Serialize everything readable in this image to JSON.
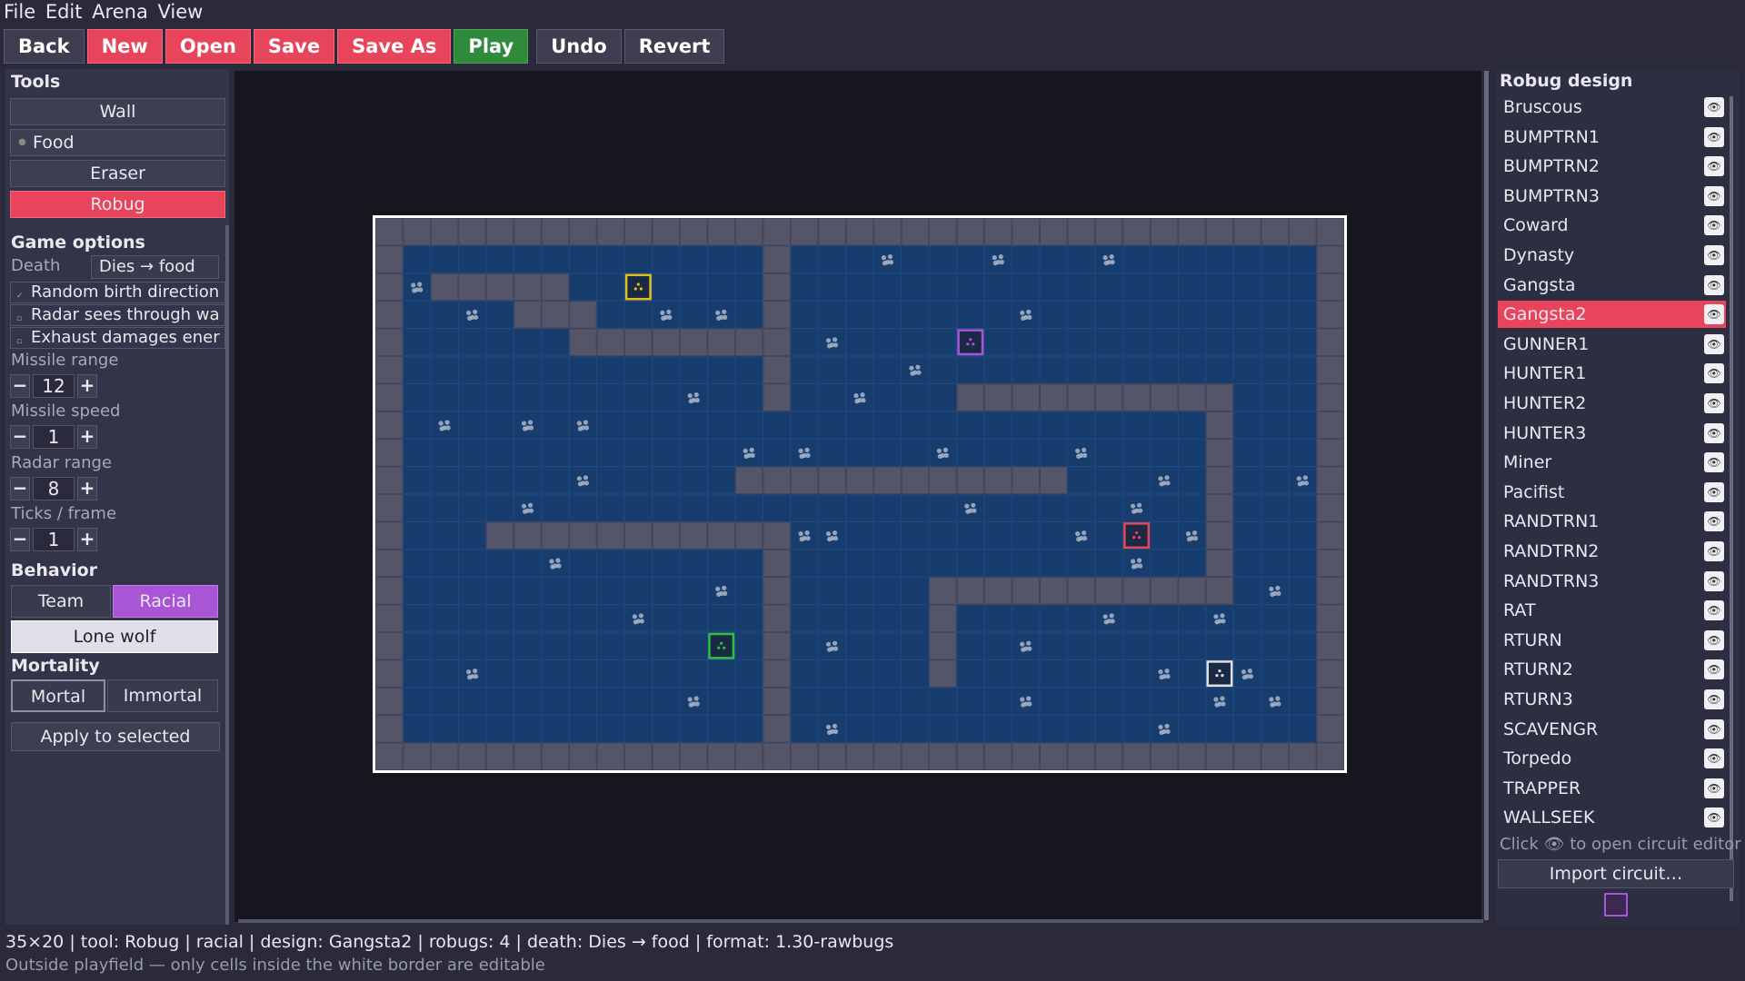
{
  "menu": [
    "File",
    "Edit",
    "Arena",
    "View"
  ],
  "toolbar": {
    "back": "Back",
    "new": "New",
    "open": "Open",
    "save": "Save",
    "save_as": "Save As",
    "play": "Play",
    "undo": "Undo",
    "revert": "Revert"
  },
  "tools": {
    "title": "Tools",
    "items": [
      "Wall",
      "Food",
      "Eraser",
      "Robug"
    ],
    "active": "Robug"
  },
  "game_options": {
    "title": "Game options",
    "death_label": "Death",
    "death_value": "Dies → food",
    "checkboxes": [
      "Random birth direction",
      "Radar sees through wa",
      "Exhaust damages ener"
    ],
    "missile_range_label": "Missile range",
    "missile_range": "12",
    "missile_speed_label": "Missile speed",
    "missile_speed": "1",
    "radar_range_label": "Radar range",
    "radar_range": "8",
    "ticks_label": "Ticks / frame",
    "ticks": "1"
  },
  "behavior": {
    "title": "Behavior",
    "team": "Team",
    "racial": "Racial",
    "lone_wolf": "Lone wolf"
  },
  "mortality": {
    "title": "Mortality",
    "mortal": "Mortal",
    "immortal": "Immortal"
  },
  "apply_label": "Apply to selected",
  "robug_design": {
    "title": "Robug design",
    "items": [
      "Bruscous",
      "BUMPTRN1",
      "BUMPTRN2",
      "BUMPTRN3",
      "Coward",
      "Dynasty",
      "Gangsta",
      "Gangsta2",
      "GUNNER1",
      "HUNTER1",
      "HUNTER2",
      "HUNTER3",
      "Miner",
      "Pacifist",
      "RANDTRN1",
      "RANDTRN2",
      "RANDTRN3",
      "RAT",
      "RTURN",
      "RTURN2",
      "RTURN3",
      "SCAVENGR",
      "Torpedo",
      "TRAPPER",
      "WALLSEEK"
    ],
    "selected": "Gangsta2",
    "hint_click": "Click",
    "hint_rest": "to open circuit editor",
    "import": "Import circuit…"
  },
  "status": {
    "line": "35×20  |  tool: Robug  |  racial  |  design: Gangsta2  |  robugs: 4  |  death: Dies → food  |  format: 1.30-rawbugs",
    "hint": "Outside playfield — only cells inside the white border are editable"
  },
  "colors": {
    "floor": "#173d6e",
    "wall": "#55556a",
    "accent_red": "#e8445c",
    "accent_green": "#2f8a3c",
    "accent_purple": "#a855d6"
  },
  "arena": {
    "cols": 35,
    "rows": 20,
    "walls": [
      [
        2,
        2
      ],
      [
        3,
        2
      ],
      [
        4,
        2
      ],
      [
        5,
        2
      ],
      [
        6,
        2
      ],
      [
        5,
        3
      ],
      [
        6,
        3
      ],
      [
        7,
        3
      ],
      [
        7,
        4
      ],
      [
        8,
        4
      ],
      [
        9,
        4
      ],
      [
        10,
        4
      ],
      [
        11,
        4
      ],
      [
        12,
        4
      ],
      [
        13,
        4
      ],
      [
        14,
        4
      ],
      [
        14,
        1
      ],
      [
        14,
        2
      ],
      [
        14,
        3
      ],
      [
        14,
        5
      ],
      [
        14,
        6
      ],
      [
        21,
        6
      ],
      [
        22,
        6
      ],
      [
        23,
        6
      ],
      [
        24,
        6
      ],
      [
        25,
        6
      ],
      [
        26,
        6
      ],
      [
        27,
        6
      ],
      [
        28,
        6
      ],
      [
        29,
        6
      ],
      [
        30,
        6
      ],
      [
        30,
        7
      ],
      [
        30,
        8
      ],
      [
        30,
        9
      ],
      [
        30,
        10
      ],
      [
        30,
        11
      ],
      [
        30,
        12
      ],
      [
        30,
        13
      ],
      [
        13,
        9
      ],
      [
        14,
        9
      ],
      [
        15,
        9
      ],
      [
        16,
        9
      ],
      [
        17,
        9
      ],
      [
        18,
        9
      ],
      [
        19,
        9
      ],
      [
        20,
        9
      ],
      [
        21,
        9
      ],
      [
        22,
        9
      ],
      [
        23,
        9
      ],
      [
        24,
        9
      ],
      [
        4,
        11
      ],
      [
        5,
        11
      ],
      [
        6,
        11
      ],
      [
        7,
        11
      ],
      [
        8,
        11
      ],
      [
        9,
        11
      ],
      [
        10,
        11
      ],
      [
        11,
        11
      ],
      [
        12,
        11
      ],
      [
        13,
        11
      ],
      [
        14,
        11
      ],
      [
        14,
        12
      ],
      [
        14,
        13
      ],
      [
        14,
        14
      ],
      [
        14,
        15
      ],
      [
        14,
        16
      ],
      [
        14,
        17
      ],
      [
        14,
        18
      ],
      [
        20,
        13
      ],
      [
        21,
        13
      ],
      [
        22,
        13
      ],
      [
        23,
        13
      ],
      [
        24,
        13
      ],
      [
        25,
        13
      ],
      [
        26,
        13
      ],
      [
        27,
        13
      ],
      [
        28,
        13
      ],
      [
        29,
        13
      ],
      [
        30,
        13
      ],
      [
        20,
        14
      ],
      [
        20,
        15
      ],
      [
        20,
        16
      ]
    ],
    "food": [
      [
        18,
        1
      ],
      [
        22,
        1
      ],
      [
        26,
        1
      ],
      [
        1,
        2
      ],
      [
        3,
        3
      ],
      [
        10,
        3
      ],
      [
        12,
        3
      ],
      [
        23,
        3
      ],
      [
        16,
        4
      ],
      [
        19,
        5
      ],
      [
        11,
        6
      ],
      [
        17,
        6
      ],
      [
        2,
        7
      ],
      [
        5,
        7
      ],
      [
        7,
        7
      ],
      [
        13,
        8
      ],
      [
        15,
        8
      ],
      [
        20,
        8
      ],
      [
        25,
        8
      ],
      [
        7,
        9
      ],
      [
        28,
        9
      ],
      [
        33,
        9
      ],
      [
        5,
        10
      ],
      [
        21,
        10
      ],
      [
        27,
        10
      ],
      [
        15,
        11
      ],
      [
        16,
        11
      ],
      [
        25,
        11
      ],
      [
        29,
        11
      ],
      [
        6,
        12
      ],
      [
        27,
        12
      ],
      [
        12,
        13
      ],
      [
        32,
        13
      ],
      [
        9,
        14
      ],
      [
        26,
        14
      ],
      [
        30,
        14
      ],
      [
        16,
        15
      ],
      [
        23,
        15
      ],
      [
        3,
        16
      ],
      [
        28,
        16
      ],
      [
        31,
        16
      ],
      [
        11,
        17
      ],
      [
        23,
        17
      ],
      [
        30,
        17
      ],
      [
        32,
        17
      ],
      [
        16,
        18
      ],
      [
        28,
        18
      ]
    ],
    "robugs": [
      {
        "c": 9,
        "r": 2,
        "color": "#e0c020"
      },
      {
        "c": 21,
        "r": 4,
        "color": "#a855d6"
      },
      {
        "c": 27,
        "r": 11,
        "color": "#e8445c"
      },
      {
        "c": 12,
        "r": 15,
        "color": "#2fbf45"
      },
      {
        "c": 30,
        "r": 16,
        "color": "#e0e0e0"
      }
    ]
  }
}
